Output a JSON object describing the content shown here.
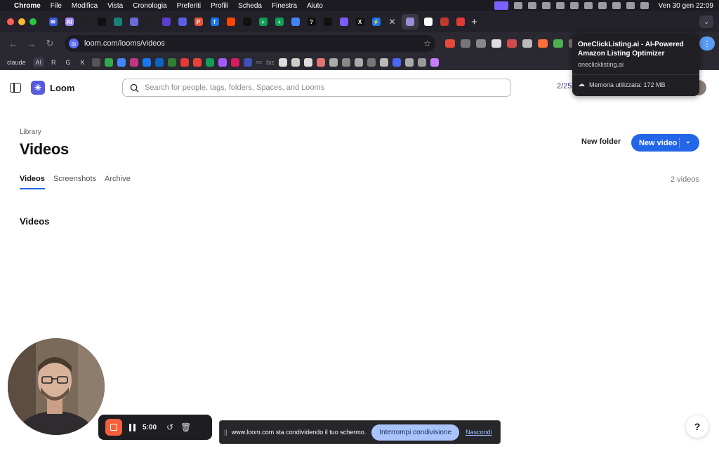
{
  "menubar": {
    "app_name": "Chrome",
    "menus": [
      "File",
      "Modifica",
      "Vista",
      "Cronologia",
      "Preferiti",
      "Profili",
      "Scheda",
      "Finestra",
      "Aiuto"
    ],
    "datetime": "Ven 30 gen  22:09"
  },
  "browser": {
    "url": "loom.com/looms/videos",
    "tab_icons": [
      "mail-icon",
      "claude-ai-icon",
      "github-icon",
      "chatgpt-icon",
      "perplexity-icon",
      "gemini-icon",
      "notion-icon",
      "slack-icon",
      "loom-icon",
      "producthunt-icon",
      "facebook-icon",
      "reddit-icon",
      "openai-icon",
      "sheets-icon",
      "sheets-icon",
      "chrome-icon",
      "black-app-icon",
      "vercel-icon",
      "purple-app-icon",
      "x-icon",
      "messenger-icon"
    ],
    "tab_glyphs": [
      "✉",
      "AI",
      "",
      "",
      "",
      "",
      "",
      "",
      "",
      "P",
      "f",
      "",
      "",
      "+",
      "+",
      "",
      "?",
      "",
      "",
      "X",
      "⚡"
    ],
    "active_tab_icon": "oneclicklisting-icon",
    "after_tabs": [
      "amazon-icon",
      "extension-icon",
      "youtube-icon"
    ],
    "bookmarks": {
      "items": [
        "claude",
        "AI",
        "R",
        "G",
        "K"
      ],
      "folder": "biz"
    }
  },
  "tooltip": {
    "title": "OneClickListing.ai - AI-Powered Amazon Listing Optimizer",
    "domain": "oneclicklisting.ai",
    "memory": "Memoria utilizzata: 172 MB"
  },
  "loom": {
    "brand": "Loom",
    "search_placeholder": "Search for people, tags, folders, Spaces, and Looms",
    "usage": "2/25",
    "breadcrumb": "Library",
    "title": "Videos",
    "new_folder": "New folder",
    "new_video": "New video",
    "tabs": [
      "Videos",
      "Screenshots",
      "Archive"
    ],
    "video_count": "2 videos",
    "section_heading": "Videos"
  },
  "recorder": {
    "timer": "5:00"
  },
  "share_bar": {
    "message": "www.loom.com sta condividendo il tuo schermo.",
    "stop_button": "Interrompi condivisione",
    "hide_link": "Nascondi"
  },
  "help": "?"
}
